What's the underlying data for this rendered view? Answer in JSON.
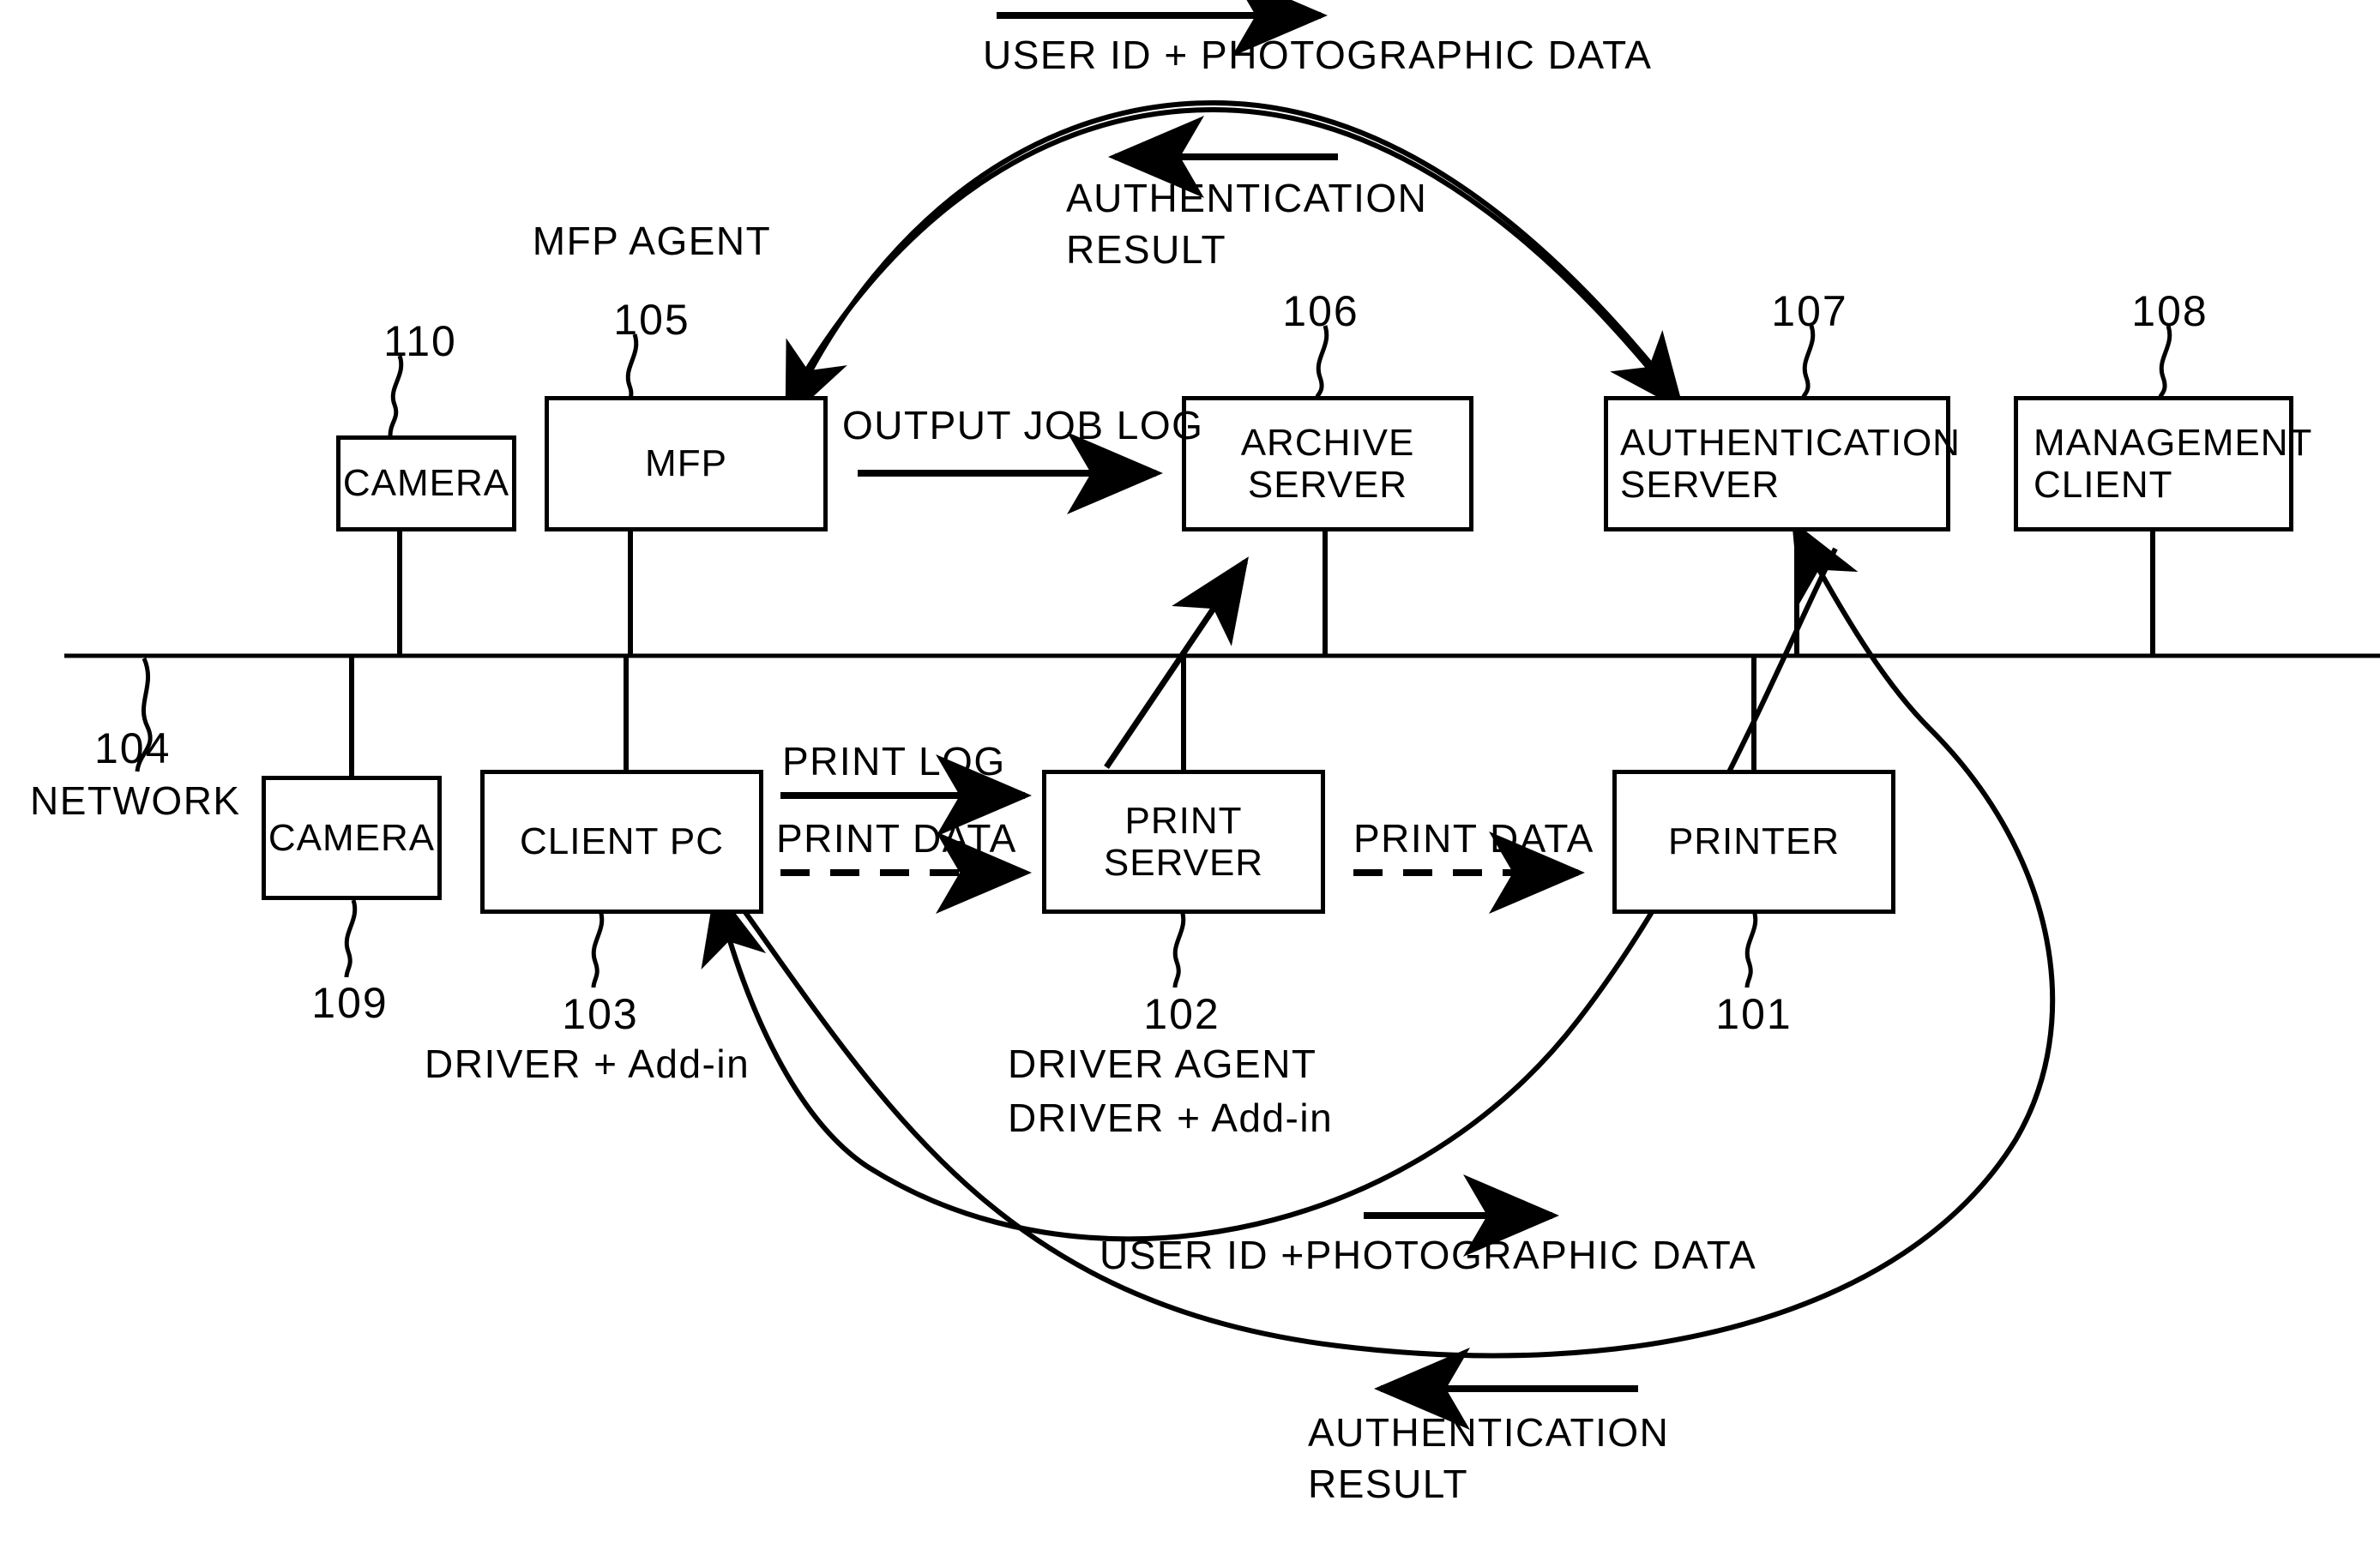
{
  "diagram": {
    "title": "Network printing and authentication system block diagram",
    "nodes": [
      {
        "id": "camera_top",
        "label_lines": [
          "CAMERA"
        ],
        "ref": "110"
      },
      {
        "id": "mfp",
        "label_lines": [
          "MFP"
        ],
        "ref": "105",
        "agent": "MFP AGENT"
      },
      {
        "id": "archive",
        "label_lines": [
          "ARCHIVE",
          "SERVER"
        ],
        "ref": "106"
      },
      {
        "id": "auth",
        "label_lines": [
          "AUTHENTICATION",
          "SERVER"
        ],
        "ref": "107"
      },
      {
        "id": "mgmt",
        "label_lines": [
          "MANAGEMENT",
          "CLIENT"
        ],
        "ref": "108"
      },
      {
        "id": "camera_bot",
        "label_lines": [
          "CAMERA"
        ],
        "ref": "109"
      },
      {
        "id": "client_pc",
        "label_lines": [
          "CLIENT PC"
        ],
        "ref": "103"
      },
      {
        "id": "print_server",
        "label_lines": [
          "PRINT",
          "SERVER"
        ],
        "ref": "102"
      },
      {
        "id": "printer",
        "label_lines": [
          "PRINTER"
        ],
        "ref": "101"
      }
    ],
    "network": {
      "ref": "104",
      "label": "NETWORK"
    },
    "annotations": {
      "mfp_agent": "MFP AGENT",
      "client_pc_sub": "DRIVER + Add-in",
      "print_server_sub_1": "DRIVER AGENT",
      "print_server_sub_2": "DRIVER + Add-in"
    },
    "flows": {
      "top_user_id": "USER ID + PHOTOGRAPHIC DATA",
      "top_auth_result_1": "AUTHENTICATION",
      "top_auth_result_2": "RESULT",
      "output_job_log": "OUTPUT JOB LOG",
      "print_log": "PRINT LOG",
      "print_data_1": "PRINT DATA",
      "print_data_2": "PRINT DATA",
      "bottom_user_id": "USER ID +PHOTOGRAPHIC DATA",
      "bottom_auth_result_1": "AUTHENTICATION",
      "bottom_auth_result_2": "RESULT"
    },
    "colors": {
      "ink": "#000000",
      "paper": "#ffffff"
    }
  }
}
